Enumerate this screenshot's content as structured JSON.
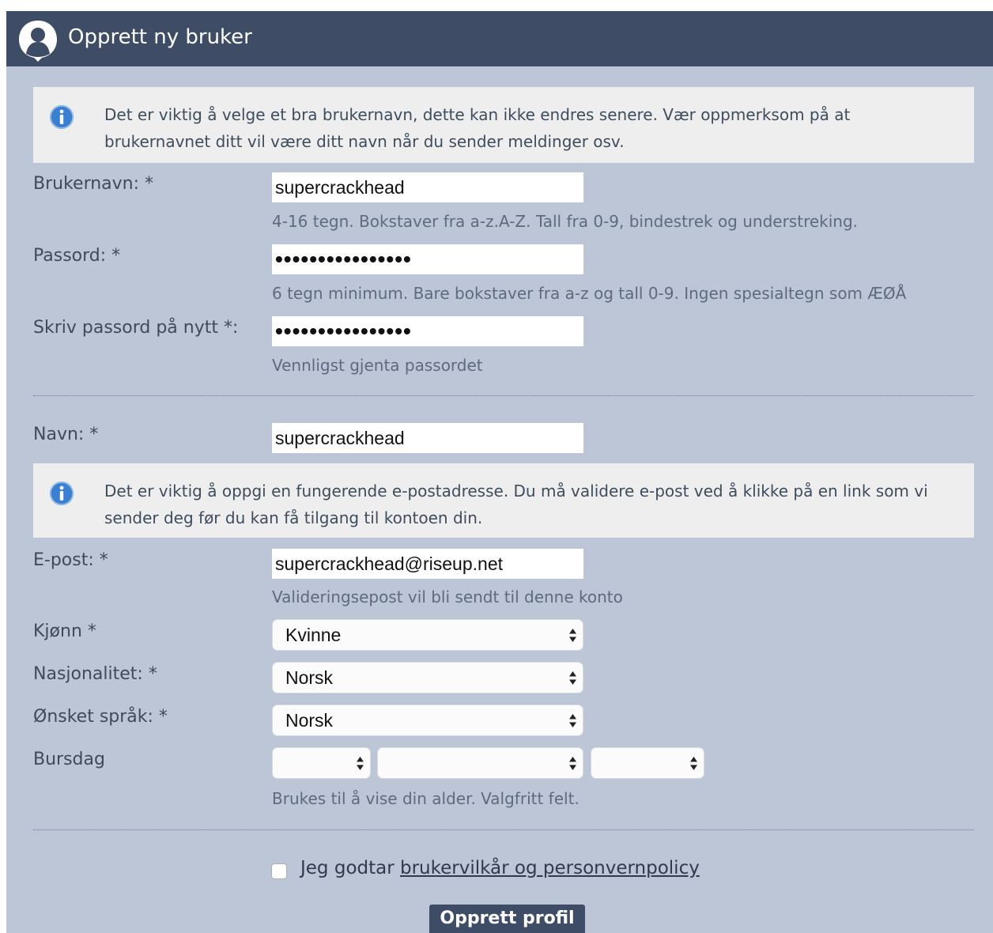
{
  "header": {
    "title": "Opprett ny bruker"
  },
  "notices": {
    "username": "Det er viktig å velge et bra brukernavn, dette kan ikke endres senere. Vær oppmerksom på at brukernavnet ditt vil være ditt navn når du sender meldinger osv.",
    "email": "Det er viktig å oppgi en fungerende e-postadresse. Du må validere e-post ved å klikke på en link som vi sender deg før du kan få tilgang til kontoen din."
  },
  "fields": {
    "username": {
      "label": "Brukernavn: *",
      "value": "supercrackhead",
      "hint": "4-16 tegn. Bokstaver fra a-z.A-Z. Tall fra 0-9, bindestrek og understreking."
    },
    "password": {
      "label": "Passord: *",
      "value": "••••••••••••••••",
      "hint": "6 tegn minimum. Bare bokstaver fra a-z og tall 0-9. Ingen spesialtegn som ÆØÅ"
    },
    "password_repeat": {
      "label": "Skriv passord på nytt *:",
      "value": "••••••••••••••••",
      "hint": "Vennligst gjenta passordet"
    },
    "name": {
      "label": "Navn: *",
      "value": "supercrackhead"
    },
    "email": {
      "label": "E-post: *",
      "value": "supercrackhead@riseup.net",
      "hint": "Valideringsepost vil bli sendt til denne konto"
    },
    "gender": {
      "label": "Kjønn *",
      "value": "Kvinne"
    },
    "nationality": {
      "label": "Nasjonalitet: *",
      "value": "Norsk"
    },
    "language": {
      "label": "Ønsket språk: *",
      "value": "Norsk"
    },
    "birthday": {
      "label": "Bursdag",
      "day": "",
      "month": "",
      "year": "",
      "hint": "Brukes til å vise din alder. Valgfritt felt."
    }
  },
  "terms": {
    "prefix": "Jeg godtar",
    "link": "brukervilkår og personvernpolicy",
    "checked": false
  },
  "submit_label": "Opprett profil",
  "colors": {
    "header_bg": "#3e4c66",
    "panel_bg": "#bcc6d6",
    "notice_bg": "#eeeeee",
    "info_icon": "#3a7fd0"
  },
  "icons": {
    "header": "user-silhouette-icon",
    "notice": "info-icon",
    "select": "updown-arrows-icon"
  }
}
